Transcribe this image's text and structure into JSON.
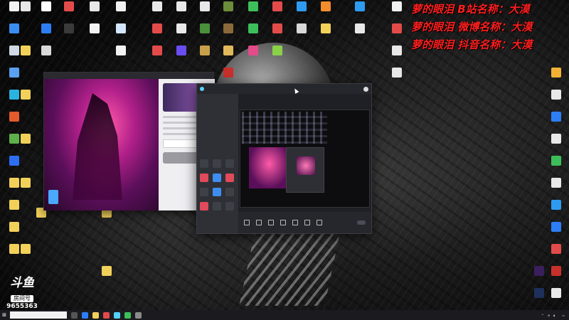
{
  "overlay": {
    "line1": "萝的眼泪 B站名称：大漠",
    "line2": "萝的眼泪 微博名称：大漠",
    "line3": "萝的眼泪 抖音名称：大漠"
  },
  "left_window": {
    "tabs": [
      "",
      "",
      "",
      ""
    ],
    "logo_text": "",
    "button_label": ""
  },
  "center_window": {
    "brand": "",
    "tag": "",
    "side_tabs": [
      "",
      ""
    ],
    "rows": [
      "",
      ""
    ],
    "preview_tabs": [
      "",
      ""
    ],
    "bottom_items": [
      "",
      "",
      "",
      "",
      "",
      "",
      ""
    ],
    "start_button": "",
    "footer": ""
  },
  "watermark": {
    "logo": "斗鱼",
    "room_label": "房间号",
    "room_number": "9655363"
  },
  "taskbar": {
    "search_placeholder": "",
    "clock_time": "",
    "clock_date": ""
  },
  "desktop_icons": [
    {
      "label": "",
      "color": "#ffffff"
    },
    {
      "label": "",
      "color": "#e34b4b"
    },
    {
      "label": "",
      "color": "#e6e6e6"
    },
    {
      "label": "",
      "color": "#2d7ef5"
    },
    {
      "label": "",
      "color": "#f2b134"
    }
  ],
  "colors": {
    "overlay_red": "#ff1f1f",
    "accent_blue": "#55d1ff",
    "taskbar": "#1b1b1f"
  }
}
